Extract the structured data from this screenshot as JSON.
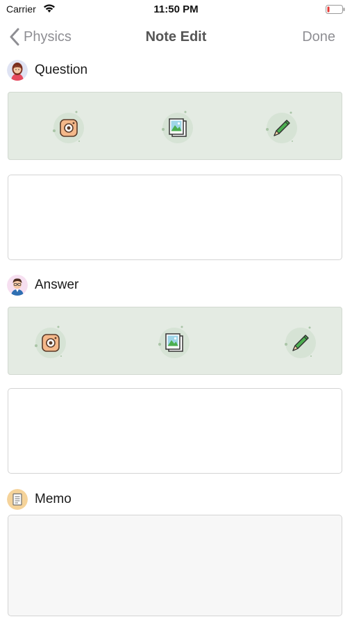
{
  "status_bar": {
    "carrier": "Carrier",
    "time": "11:50 PM",
    "battery_color": "#e53935"
  },
  "nav": {
    "back_label": "Physics",
    "title": "Note Edit",
    "done_label": "Done"
  },
  "question": {
    "label": "Question",
    "avatar_icon": "girl-avatar-icon",
    "tools": [
      "camera-icon",
      "gallery-icon",
      "pencil-icon"
    ],
    "text": ""
  },
  "answer": {
    "label": "Answer",
    "avatar_icon": "boy-avatar-icon",
    "tools": [
      "camera-icon",
      "gallery-icon",
      "pencil-icon"
    ],
    "text": ""
  },
  "memo": {
    "label": "Memo",
    "icon": "memo-icon",
    "text": ""
  },
  "colors": {
    "panel_bg": "#e4ebe3",
    "nav_gray": "#8e8e93"
  }
}
